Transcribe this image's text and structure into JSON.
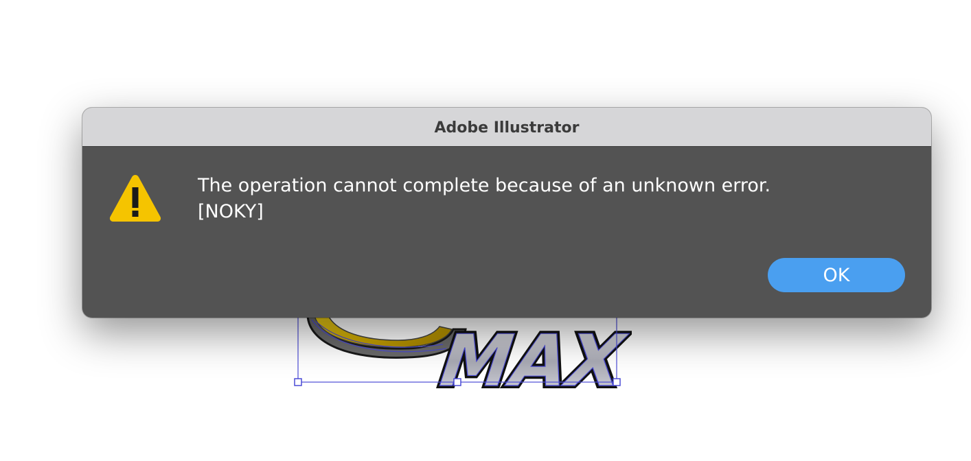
{
  "dialog": {
    "title": "Adobe Illustrator",
    "message_line1": "The operation cannot complete because of an unknown error.",
    "message_line2": "[NOKY]",
    "ok_label": "OK",
    "icon": "warning-icon"
  },
  "artwork": {
    "logo_text": "MAX"
  },
  "colors": {
    "titlebar_bg": "#d6d6d8",
    "dialog_bg": "#535353",
    "button_bg": "#4a9ff0",
    "warning_yellow": "#f5c400",
    "selection_blue": "#4b4bd6"
  }
}
